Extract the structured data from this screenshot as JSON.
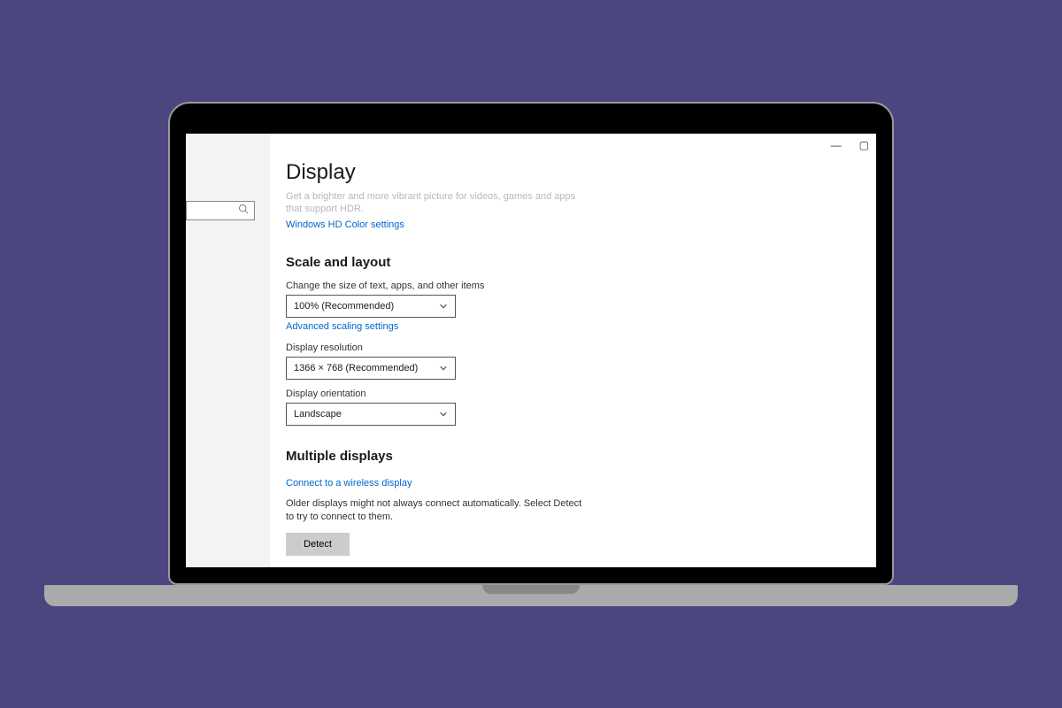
{
  "page": {
    "title": "Display",
    "hdr_desc": "Get a brighter and more vibrant picture for videos, games and apps that support HDR.",
    "hdr_link": "Windows HD Color settings"
  },
  "scale": {
    "heading": "Scale and layout",
    "text_size_label": "Change the size of text, apps, and other items",
    "text_size_value": "100% (Recommended)",
    "advanced_link": "Advanced scaling settings",
    "resolution_label": "Display resolution",
    "resolution_value": "1366 × 768 (Recommended)",
    "orientation_label": "Display orientation",
    "orientation_value": "Landscape"
  },
  "multiple": {
    "heading": "Multiple displays",
    "wireless_link": "Connect to a wireless display",
    "older_text": "Older displays might not always connect automatically. Select Detect to try to connect to them.",
    "detect_label": "Detect"
  },
  "window": {
    "minimize": "—"
  }
}
